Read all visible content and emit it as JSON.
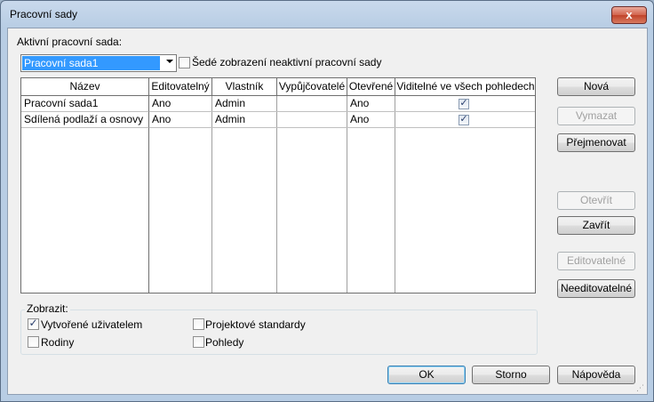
{
  "window": {
    "title": "Pracovní sady",
    "close_glyph": "x"
  },
  "active_label": "Aktivní pracovní sada:",
  "active_value": "Pracovní sada1",
  "gray_inactive": {
    "label": "Šedé zobrazení neaktivní pracovní sady",
    "checked": false
  },
  "table": {
    "headers": [
      "Název",
      "Editovatelný",
      "Vlastník",
      "Vypůjčovatelé",
      "Otevřené",
      "Viditelné ve všech pohledech"
    ],
    "rows": [
      {
        "name": "Pracovní sada1",
        "editable": "Ano",
        "owner": "Admin",
        "borrowers": "",
        "opened": "Ano",
        "visible_all": true
      },
      {
        "name": "Sdílená podlaží a osnovy",
        "editable": "Ano",
        "owner": "Admin",
        "borrowers": "",
        "opened": "Ano",
        "visible_all": true
      }
    ]
  },
  "buttons": {
    "new": "Nová",
    "delete": "Vymazat",
    "rename": "Přejmenovat",
    "open": "Otevřít",
    "close": "Zavřít",
    "editable": "Editovatelné",
    "non_editable": "Needitovatelné",
    "ok": "OK",
    "cancel": "Storno",
    "help": "Nápověda"
  },
  "show_group": {
    "title": "Zobrazit:",
    "options": [
      {
        "label": "Vytvořené uživatelem",
        "checked": true
      },
      {
        "label": "Projektové standardy",
        "checked": false
      },
      {
        "label": "Rodiny",
        "checked": false
      },
      {
        "label": "Pohledy",
        "checked": false
      }
    ]
  },
  "icons": {
    "check": "✓",
    "dropdown": "chevron-down-icon",
    "grip": "resize-grip-icon"
  }
}
